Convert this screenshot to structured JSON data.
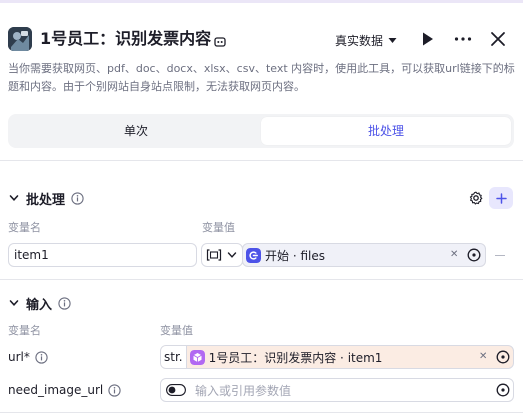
{
  "header": {
    "title": "1号员工：识别发票内容",
    "mode": "真实数据",
    "description": "当你需要获取网页、pdf、doc、docx、xlsx、csv、text 内容时，使用此工具，可以获取url链接下的标题和内容。由于个别网站自身站点限制，无法获取网页内容。"
  },
  "tabs": [
    {
      "label": "单次",
      "active": false
    },
    {
      "label": "批处理",
      "active": true
    }
  ],
  "batch": {
    "title": "批处理",
    "col_name": "变量名",
    "col_value": "变量值",
    "var_name": "item1",
    "ref_text": "开始 · files"
  },
  "inputs": {
    "title": "输入",
    "col_name": "变量名",
    "col_value": "变量值",
    "params": [
      {
        "name": "url",
        "required_mark": "*",
        "type_tag": "str.",
        "ref_text": "1号员工：识别发票内容 · item1"
      },
      {
        "name": "need_image_url",
        "required_mark": "",
        "placeholder": "输入或引用参数值"
      }
    ]
  },
  "colors": {
    "accent": "#4d53e8",
    "ref_bg_batch": "#f0f1f8",
    "ref_bg_url": "#fbece3",
    "start_icon": "#4d53e8",
    "node_ref_icon": "#b169f2"
  },
  "icons": {
    "play": "play-icon",
    "more": "more-icon",
    "close": "close-icon",
    "gear": "gear-icon",
    "add": "plus-icon",
    "info": "info-icon"
  }
}
